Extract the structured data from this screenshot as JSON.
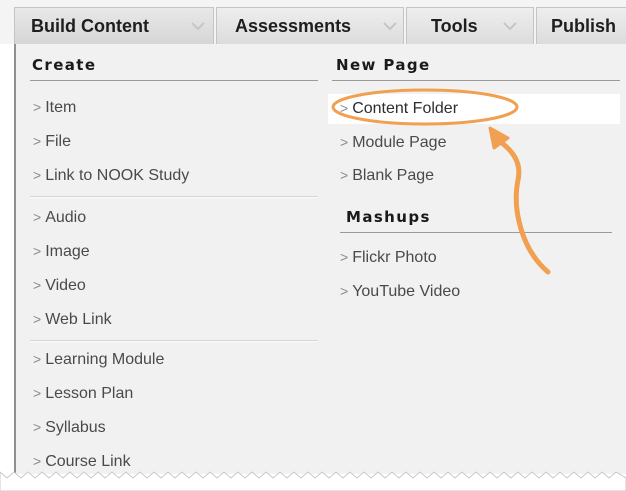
{
  "tabs": [
    {
      "label": "Build Content"
    },
    {
      "label": "Assessments"
    },
    {
      "label": "Tools"
    },
    {
      "label": "Publish"
    }
  ],
  "menu": {
    "create": {
      "header": "Create",
      "items": [
        "Item",
        "File",
        "Link to NOOK Study",
        "Audio",
        "Image",
        "Video",
        "Web Link",
        "Learning Module",
        "Lesson Plan",
        "Syllabus",
        "Course Link"
      ]
    },
    "new_page": {
      "header": "New Page",
      "items": [
        "Content Folder",
        "Module Page",
        "Blank Page"
      ]
    },
    "mashups": {
      "header": "Mashups",
      "items": [
        "Flickr Photo",
        "YouTube Video"
      ]
    }
  },
  "colors": {
    "callout": "#f0a050",
    "highlight_bg": "#ffffff"
  },
  "bullet_glyph": ">"
}
